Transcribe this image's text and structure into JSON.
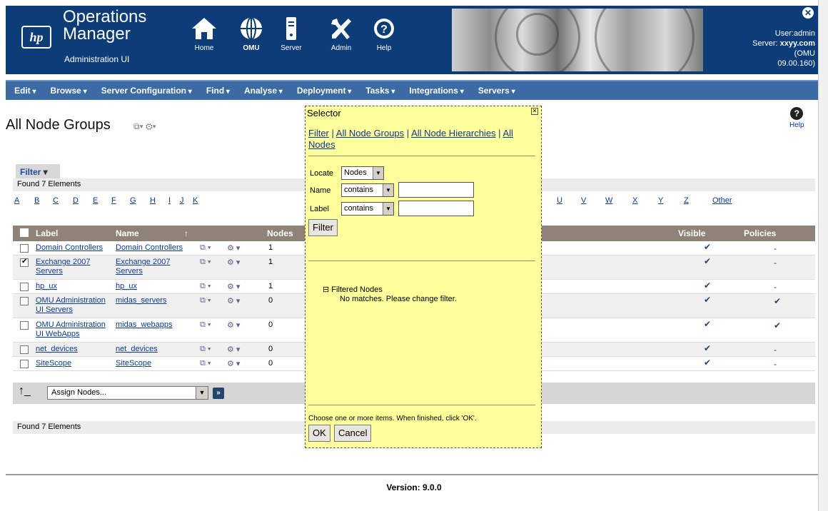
{
  "header": {
    "logo_text": "hp",
    "title_line1": "Operations",
    "title_line2": "Manager",
    "subtitle": "Administration UI",
    "nav": [
      {
        "label": "Home"
      },
      {
        "label": "OMU"
      },
      {
        "label": "Server"
      },
      {
        "label": "Admin"
      },
      {
        "label": "Help"
      }
    ],
    "user_label": "User:admin",
    "server_label": "Server:",
    "server_value": "xxyy.com",
    "server_extra1": "(OMU",
    "server_extra2": "09.00.160)"
  },
  "menubar": [
    "Edit",
    "Browse",
    "Server Configuration",
    "Find",
    "Analyse",
    "Deployment",
    "Tasks",
    "Integrations",
    "Servers"
  ],
  "page": {
    "title": "All Node Groups",
    "help": "Help",
    "filter": "Filter",
    "found_top": "Found 7 Elements",
    "found_bottom": "Found 7 Elements",
    "alphabet_left": [
      "A",
      "B",
      "C",
      "D",
      "E",
      "F",
      "G",
      "H",
      "I",
      "J",
      "K"
    ],
    "alphabet_right": [
      "U",
      "V",
      "W",
      "X",
      "Y",
      "Z",
      "Other"
    ],
    "version": "Version: 9.0.0"
  },
  "table": {
    "headers": {
      "label": "Label",
      "name": "Name",
      "nodes": "Nodes",
      "visible": "Visible",
      "policies": "Policies"
    },
    "rows": [
      {
        "label": "Domain Controllers",
        "name": "Domain Controllers",
        "nodes": "1",
        "visible": "✔",
        "policies": "-",
        "checked": false
      },
      {
        "label": "Exchange 2007 Servers",
        "name": "Exchange 2007 Servers",
        "nodes": "1",
        "visible": "✔",
        "policies": "-",
        "checked": true
      },
      {
        "label": "hp_ux",
        "name": "hp_ux",
        "nodes": "1",
        "visible": "✔",
        "policies": "-",
        "checked": false
      },
      {
        "label": "OMU Administration UI Servers",
        "name": "midas_servers",
        "nodes": "0",
        "visible": "✔",
        "policies": "✔",
        "checked": false
      },
      {
        "label": "OMU Administration UI WebApps",
        "name": "midas_webapps",
        "nodes": "0",
        "visible": "✔",
        "policies": "✔",
        "checked": false
      },
      {
        "label": "net_devices",
        "name": "net_devices",
        "nodes": "0",
        "visible": "✔",
        "policies": "-",
        "checked": false
      },
      {
        "label": "SiteScope",
        "name": "SiteScope",
        "nodes": "0",
        "visible": "✔",
        "policies": "-",
        "checked": false
      }
    ],
    "assign_select": "Assign Nodes..."
  },
  "selector": {
    "title": "Selector",
    "link_filter": "Filter",
    "link_all_groups": "All Node Groups",
    "link_all_hier": "All Node Hierarchies",
    "link_all_nodes": "All Nodes",
    "locate_label": "Locate",
    "locate_value": "Nodes",
    "name_label": "Name",
    "name_op": "contains",
    "label_label": "Label",
    "label_op": "contains",
    "filter_button": "Filter",
    "filtered_nodes": "Filtered Nodes",
    "no_matches": "No matches. Please change filter.",
    "hint": "Choose one or more items. When finished, click 'OK'.",
    "ok": "OK",
    "cancel": "Cancel"
  },
  "colors": {
    "header_bg": "#0d3d78",
    "menubar_bg": "#3b6aa5",
    "table_header_bg": "#8f8377",
    "selector_bg": "#ffff9c"
  }
}
